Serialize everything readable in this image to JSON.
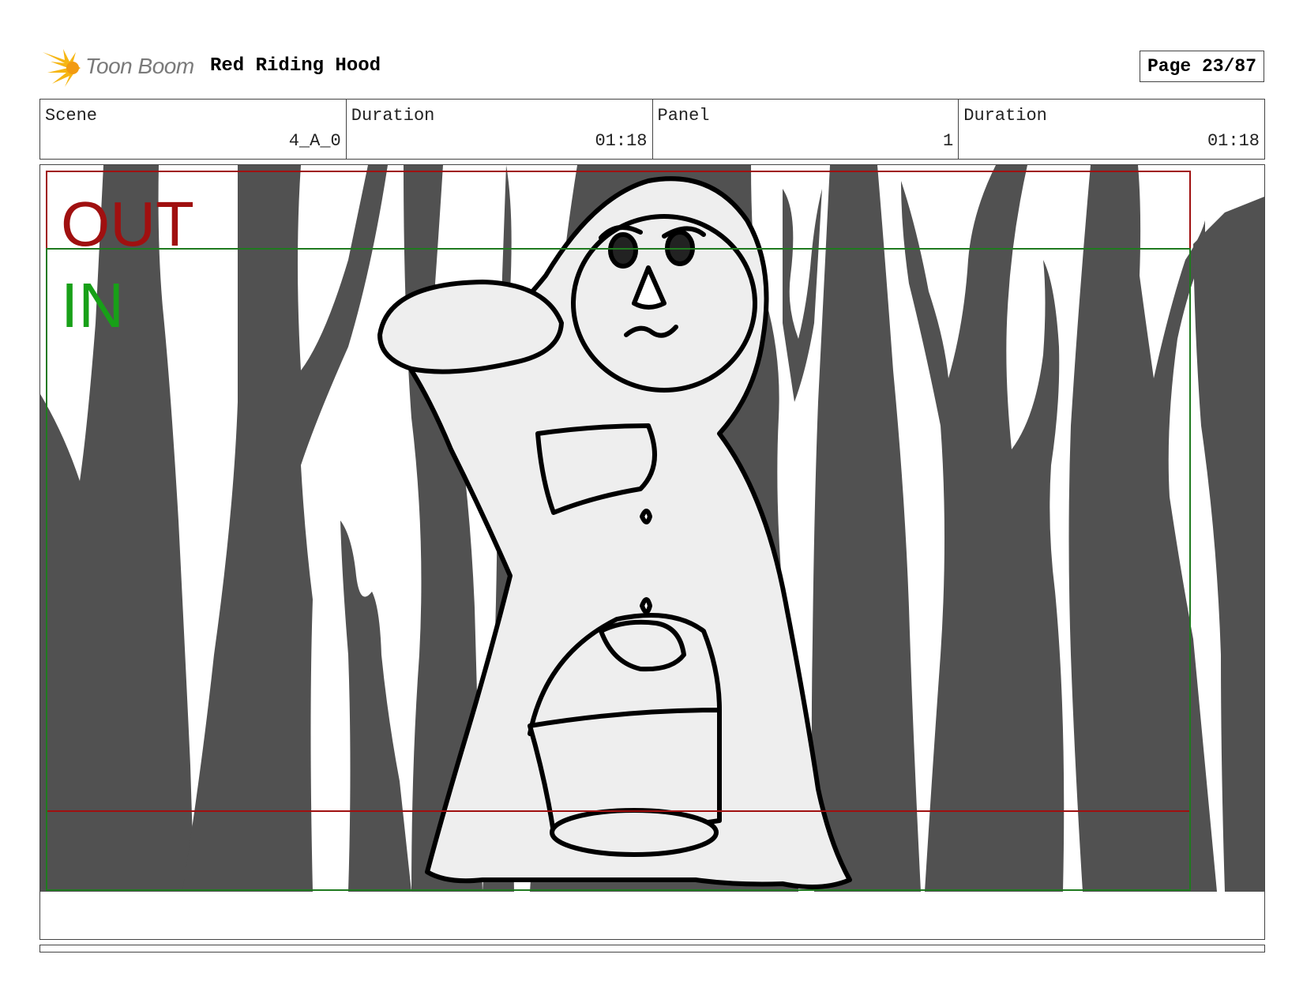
{
  "header": {
    "brand_name": "Toon Boom",
    "project_title": "Red Riding Hood",
    "page_label": "Page 23/87"
  },
  "info": {
    "scene_label": "Scene",
    "scene_value": "4_A_0",
    "scene_duration_label": "Duration",
    "scene_duration_value": "01:18",
    "panel_label": "Panel",
    "panel_value": "1",
    "panel_duration_label": "Duration",
    "panel_duration_value": "01:18"
  },
  "panel": {
    "out_label": "OUT",
    "in_label": "IN",
    "colors": {
      "out_frame": "#a01010",
      "in_frame": "#1f7a1f",
      "in_text": "#18a018",
      "trees": "#515151",
      "figure_fill": "#eeeeee",
      "ink": "#000000"
    }
  },
  "icons": {
    "logo": "starburst-logo-icon"
  }
}
